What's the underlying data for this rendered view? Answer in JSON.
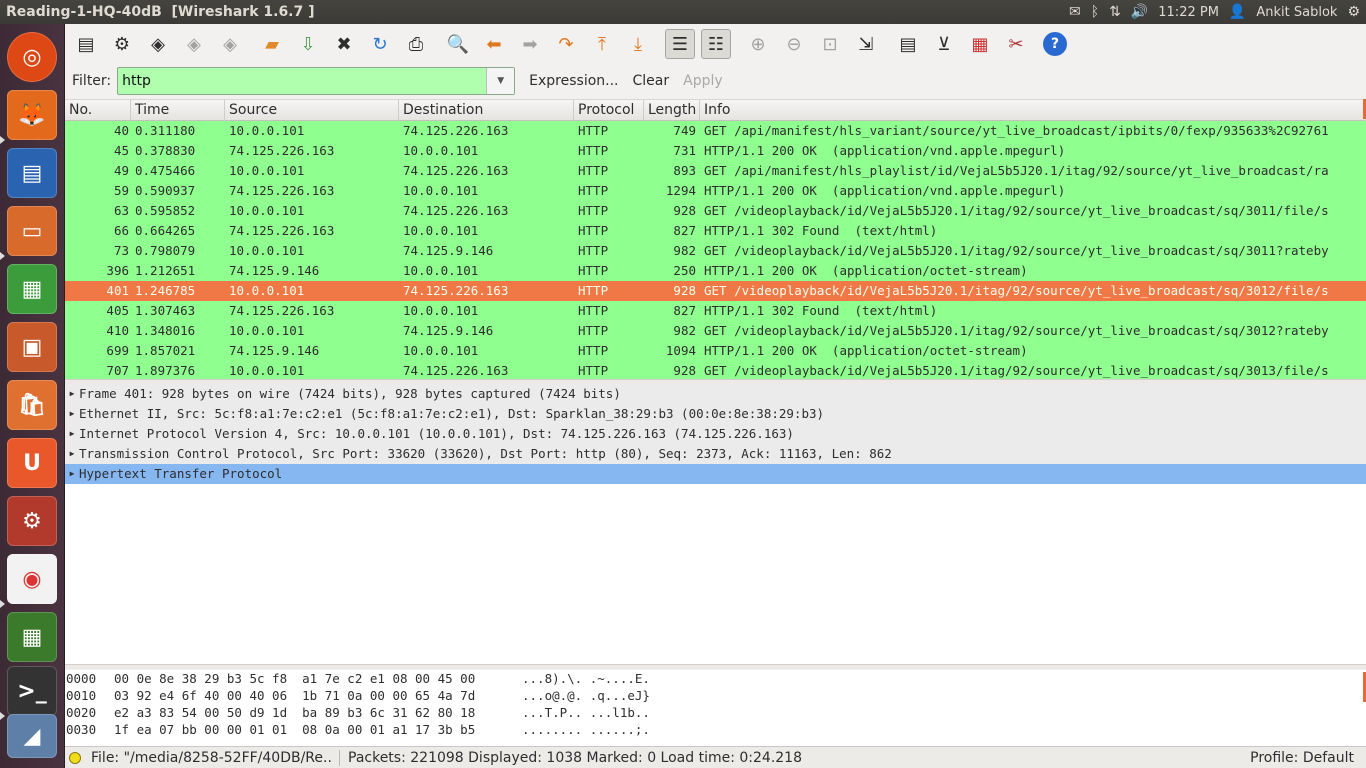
{
  "topbar": {
    "title": "Reading-1-HQ-40dB  [Wireshark 1.6.7 ]",
    "time": "11:22 PM",
    "user": "Ankit Sablok"
  },
  "filter": {
    "label": "Filter:",
    "value": "http",
    "expression": "Expression...",
    "clear": "Clear",
    "apply": "Apply"
  },
  "columns": [
    "No.",
    "Time",
    "Source",
    "Destination",
    "Protocol",
    "Length",
    "Info"
  ],
  "packets": [
    {
      "no": "40",
      "time": "0.311180",
      "src": "10.0.0.101",
      "dst": "74.125.226.163",
      "proto": "HTTP",
      "len": "749",
      "info": "GET /api/manifest/hls_variant/source/yt_live_broadcast/ipbits/0/fexp/935633%2C92761"
    },
    {
      "no": "45",
      "time": "0.378830",
      "src": "74.125.226.163",
      "dst": "10.0.0.101",
      "proto": "HTTP",
      "len": "731",
      "info": "HTTP/1.1 200 OK  (application/vnd.apple.mpegurl)"
    },
    {
      "no": "49",
      "time": "0.475466",
      "src": "10.0.0.101",
      "dst": "74.125.226.163",
      "proto": "HTTP",
      "len": "893",
      "info": "GET /api/manifest/hls_playlist/id/VejaL5b5J20.1/itag/92/source/yt_live_broadcast/ra"
    },
    {
      "no": "59",
      "time": "0.590937",
      "src": "74.125.226.163",
      "dst": "10.0.0.101",
      "proto": "HTTP",
      "len": "1294",
      "info": "HTTP/1.1 200 OK  (application/vnd.apple.mpegurl)"
    },
    {
      "no": "63",
      "time": "0.595852",
      "src": "10.0.0.101",
      "dst": "74.125.226.163",
      "proto": "HTTP",
      "len": "928",
      "info": "GET /videoplayback/id/VejaL5b5J20.1/itag/92/source/yt_live_broadcast/sq/3011/file/s"
    },
    {
      "no": "66",
      "time": "0.664265",
      "src": "74.125.226.163",
      "dst": "10.0.0.101",
      "proto": "HTTP",
      "len": "827",
      "info": "HTTP/1.1 302 Found  (text/html)"
    },
    {
      "no": "73",
      "time": "0.798079",
      "src": "10.0.0.101",
      "dst": "74.125.9.146",
      "proto": "HTTP",
      "len": "982",
      "info": "GET /videoplayback/id/VejaL5b5J20.1/itag/92/source/yt_live_broadcast/sq/3011?rateby"
    },
    {
      "no": "396",
      "time": "1.212651",
      "src": "74.125.9.146",
      "dst": "10.0.0.101",
      "proto": "HTTP",
      "len": "250",
      "info": "HTTP/1.1 200 OK  (application/octet-stream)"
    },
    {
      "no": "401",
      "time": "1.246785",
      "src": "10.0.0.101",
      "dst": "74.125.226.163",
      "proto": "HTTP",
      "len": "928",
      "info": "GET /videoplayback/id/VejaL5b5J20.1/itag/92/source/yt_live_broadcast/sq/3012/file/s",
      "selected": true
    },
    {
      "no": "405",
      "time": "1.307463",
      "src": "74.125.226.163",
      "dst": "10.0.0.101",
      "proto": "HTTP",
      "len": "827",
      "info": "HTTP/1.1 302 Found  (text/html)"
    },
    {
      "no": "410",
      "time": "1.348016",
      "src": "10.0.0.101",
      "dst": "74.125.9.146",
      "proto": "HTTP",
      "len": "982",
      "info": "GET /videoplayback/id/VejaL5b5J20.1/itag/92/source/yt_live_broadcast/sq/3012?rateby"
    },
    {
      "no": "699",
      "time": "1.857021",
      "src": "74.125.9.146",
      "dst": "10.0.0.101",
      "proto": "HTTP",
      "len": "1094",
      "info": "HTTP/1.1 200 OK  (application/octet-stream)"
    },
    {
      "no": "707",
      "time": "1.897376",
      "src": "10.0.0.101",
      "dst": "74.125.226.163",
      "proto": "HTTP",
      "len": "928",
      "info": "GET /videoplayback/id/VejaL5b5J20.1/itag/92/source/yt_live_broadcast/sq/3013/file/s"
    }
  ],
  "details": [
    {
      "text": "Frame 401: 928 bytes on wire (7424 bits), 928 bytes captured (7424 bits)"
    },
    {
      "text": "Ethernet II, Src: 5c:f8:a1:7e:c2:e1 (5c:f8:a1:7e:c2:e1), Dst: Sparklan_38:29:b3 (00:0e:8e:38:29:b3)"
    },
    {
      "text": "Internet Protocol Version 4, Src: 10.0.0.101 (10.0.0.101), Dst: 74.125.226.163 (74.125.226.163)"
    },
    {
      "text": "Transmission Control Protocol, Src Port: 33620 (33620), Dst Port: http (80), Seq: 2373, Ack: 11163, Len: 862"
    },
    {
      "text": "Hypertext Transfer Protocol",
      "selected": true
    }
  ],
  "hex": [
    {
      "off": "0000",
      "bytes": "00 0e 8e 38 29 b3 5c f8  a1 7e c2 e1 08 00 45 00",
      "ascii": "...8).\\. .~....E."
    },
    {
      "off": "0010",
      "bytes": "03 92 e4 6f 40 00 40 06  1b 71 0a 00 00 65 4a 7d",
      "ascii": "...o@.@. .q...eJ}"
    },
    {
      "off": "0020",
      "bytes": "e2 a3 83 54 00 50 d9 1d  ba 89 b3 6c 31 62 80 18",
      "ascii": "...T.P.. ...l1b.."
    },
    {
      "off": "0030",
      "bytes": "1f ea 07 bb 00 00 01 01  08 0a 00 01 a1 17 3b b5",
      "ascii": "........ ......;."
    }
  ],
  "status": {
    "file": "File: \"/media/8258-52FF/40DB/Re...",
    "packets": "Packets: 221098 Displayed: 1038 Marked: 0 Load time: 0:24.218",
    "profile": "Profile: Default"
  },
  "colors": {
    "http_row": "#8fff8f",
    "selected_row": "#f07846",
    "detail_selected": "#86b7f0",
    "filter_valid": "#afffaf"
  }
}
